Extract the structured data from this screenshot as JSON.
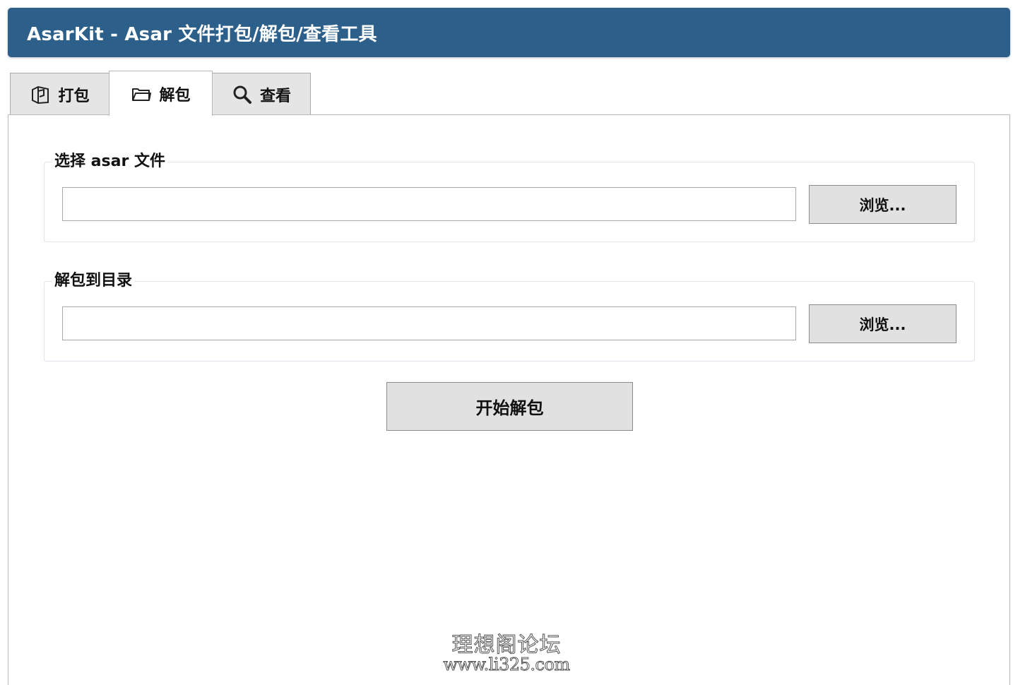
{
  "window": {
    "title": "AsarKit - Asar 文件打包/解包/查看工具"
  },
  "tabs": [
    {
      "label": "打包",
      "icon": "package-icon"
    },
    {
      "label": "解包",
      "icon": "folder-open-icon",
      "active": true
    },
    {
      "label": "查看",
      "icon": "magnifier-icon"
    }
  ],
  "unpack": {
    "asar_group": {
      "legend": "选择 asar 文件",
      "input_value": "",
      "browse_label": "浏览..."
    },
    "output_group": {
      "legend": "解包到目录",
      "input_value": "",
      "browse_label": "浏览..."
    },
    "start_label": "开始解包"
  },
  "watermark": {
    "line1": "理想阁论坛",
    "line2": "www.li325.com"
  },
  "colors": {
    "title_bar": "#2c5f8a",
    "button_bg": "#e1e1e1"
  }
}
